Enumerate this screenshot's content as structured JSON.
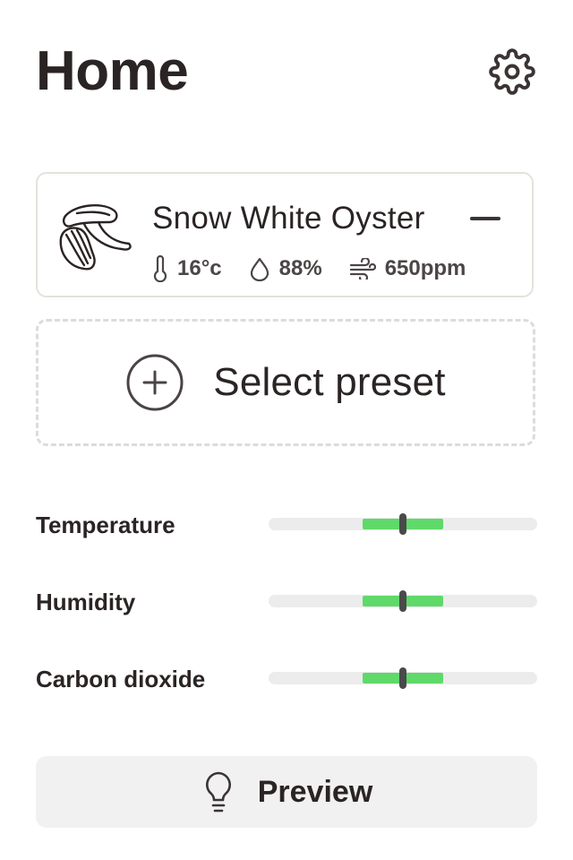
{
  "header": {
    "title": "Home",
    "settings_icon": "gear-icon"
  },
  "active_preset": {
    "name": "Snow White Oyster",
    "icon": "mushroom-icon",
    "remove_icon": "minus-icon",
    "stats": {
      "temperature": {
        "icon": "thermometer-icon",
        "value": "16°c"
      },
      "humidity": {
        "icon": "droplet-icon",
        "value": "88%"
      },
      "co2": {
        "icon": "wind-icon",
        "value": "650ppm"
      }
    }
  },
  "select_preset": {
    "label": "Select preset",
    "icon": "plus-circle-icon"
  },
  "controls": {
    "temperature": {
      "label": "Temperature",
      "range_start": 0.35,
      "range_end": 0.65,
      "value": 0.5
    },
    "humidity": {
      "label": "Humidity",
      "range_start": 0.35,
      "range_end": 0.65,
      "value": 0.5
    },
    "carbon_dioxide": {
      "label": "Carbon dioxide",
      "range_start": 0.35,
      "range_end": 0.65,
      "value": 0.5
    }
  },
  "preview": {
    "label": "Preview",
    "icon": "lightbulb-icon"
  },
  "colors": {
    "text": "#2b2424",
    "accent_green": "#5fd96a",
    "track": "#ececec",
    "card_border": "#e4e2da"
  }
}
